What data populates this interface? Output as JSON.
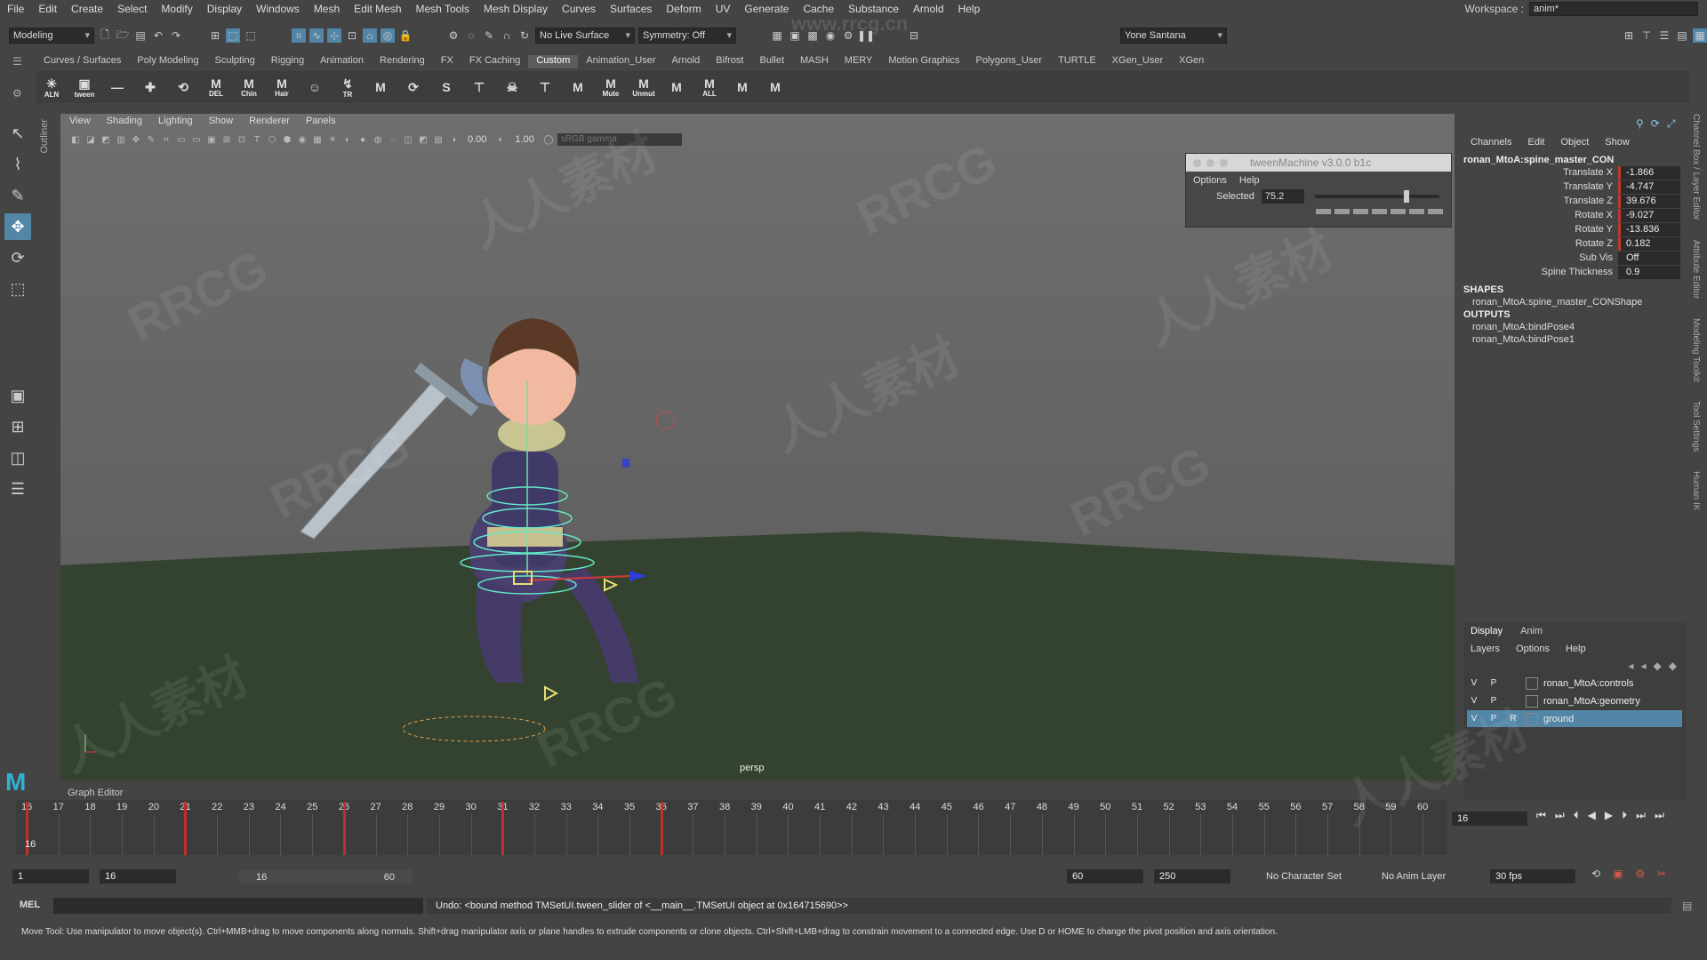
{
  "menubar": {
    "items": [
      "File",
      "Edit",
      "Create",
      "Select",
      "Modify",
      "Display",
      "Windows",
      "Mesh",
      "Edit Mesh",
      "Mesh Tools",
      "Mesh Display",
      "Curves",
      "Surfaces",
      "Deform",
      "UV",
      "Generate",
      "Cache",
      "Substance",
      "Arnold",
      "Help"
    ],
    "workspace_label": "Workspace :",
    "workspace_value": "anim*"
  },
  "statusline": {
    "mode": "Modeling",
    "live_surface": "No Live Surface",
    "symmetry": "Symmetry: Off",
    "user": "Yone Santana"
  },
  "shelf": {
    "tabs": [
      "Curves / Surfaces",
      "Poly Modeling",
      "Sculpting",
      "Rigging",
      "Animation",
      "Rendering",
      "FX",
      "FX Caching",
      "Custom",
      "Animation_User",
      "Arnold",
      "Bifrost",
      "Bullet",
      "MASH",
      "MERY",
      "Motion Graphics",
      "Polygons_User",
      "TURTLE",
      "XGen_User",
      "XGen"
    ],
    "active_tab": "Custom",
    "buttons": [
      {
        "glyph": "✳",
        "label": "ALN"
      },
      {
        "glyph": "▣",
        "label": "tween"
      },
      {
        "glyph": "—",
        "label": ""
      },
      {
        "glyph": "✚",
        "label": ""
      },
      {
        "glyph": "⟲",
        "label": ""
      },
      {
        "glyph": "M",
        "label": "DEL"
      },
      {
        "glyph": "M",
        "label": "Chin"
      },
      {
        "glyph": "M",
        "label": "Hair"
      },
      {
        "glyph": "☺",
        "label": ""
      },
      {
        "glyph": "↯",
        "label": "TR"
      },
      {
        "glyph": "M",
        "label": ""
      },
      {
        "glyph": "⟳",
        "label": ""
      },
      {
        "glyph": "S",
        "label": ""
      },
      {
        "glyph": "⊤",
        "label": ""
      },
      {
        "glyph": "☠",
        "label": ""
      },
      {
        "glyph": "⊤",
        "label": ""
      },
      {
        "glyph": "M",
        "label": ""
      },
      {
        "glyph": "M",
        "label": "Mute"
      },
      {
        "glyph": "M",
        "label": "Unmut"
      },
      {
        "glyph": "M",
        "label": ""
      },
      {
        "glyph": "M",
        "label": "ALL"
      },
      {
        "glyph": "M",
        "label": ""
      },
      {
        "glyph": "M",
        "label": ""
      }
    ]
  },
  "viewport": {
    "menu": [
      "View",
      "Shading",
      "Lighting",
      "Show",
      "Renderer",
      "Panels"
    ],
    "exposure": "0.00",
    "gamma": "1.00",
    "colorspace": "sRGB gamma",
    "camera": "persp",
    "outliner_label": "Outliner"
  },
  "tween_machine": {
    "title": "tweenMachine v3.0.0 b1c",
    "menu": [
      "Options",
      "Help"
    ],
    "selected_label": "Selected",
    "value": "75.2",
    "slider_fraction": 0.75
  },
  "channel_box": {
    "menu": [
      "Channels",
      "Edit",
      "Object",
      "Show"
    ],
    "node": "ronan_MtoA:spine_master_CON",
    "attributes": [
      {
        "name": "Translate X",
        "value": "-1.866",
        "keyed": true
      },
      {
        "name": "Translate Y",
        "value": "-4.747",
        "keyed": true
      },
      {
        "name": "Translate Z",
        "value": "39.676",
        "keyed": true
      },
      {
        "name": "Rotate X",
        "value": "-9.027",
        "keyed": true
      },
      {
        "name": "Rotate Y",
        "value": "-13.836",
        "keyed": true
      },
      {
        "name": "Rotate Z",
        "value": "0.182",
        "keyed": true
      },
      {
        "name": "Sub Vis",
        "value": "Off",
        "keyed": false
      },
      {
        "name": "Spine Thickness",
        "value": "0.9",
        "keyed": false
      }
    ],
    "shapes_header": "SHAPES",
    "shapes": [
      "ronan_MtoA:spine_master_CONShape"
    ],
    "outputs_header": "OUTPUTS",
    "outputs": [
      "ronan_MtoA:bindPose4",
      "ronan_MtoA:bindPose1"
    ]
  },
  "right_tabs": [
    "Channel Box / Layer Editor",
    "Attribute Editor",
    "Modeling Toolkit",
    "Tool Settings",
    "Human IK"
  ],
  "layers": {
    "tabs": [
      "Display",
      "Anim"
    ],
    "menu": [
      "Layers",
      "Options",
      "Help"
    ],
    "rows": [
      {
        "v": "V",
        "p": "P",
        "r": "",
        "name": "ronan_MtoA:controls",
        "selected": false
      },
      {
        "v": "V",
        "p": "P",
        "r": "",
        "name": "ronan_MtoA:geometry",
        "selected": false
      },
      {
        "v": "V",
        "p": "P",
        "r": "R",
        "name": "ground",
        "selected": true
      }
    ]
  },
  "timeline": {
    "graph_editor_label": "Graph Editor",
    "frames": [
      "16",
      "17",
      "18",
      "19",
      "20",
      "21",
      "22",
      "23",
      "24",
      "25",
      "26",
      "27",
      "28",
      "29",
      "30",
      "31",
      "32",
      "33",
      "34",
      "35",
      "36",
      "37",
      "38",
      "39",
      "40",
      "41",
      "42",
      "43",
      "44",
      "45",
      "46",
      "47",
      "48",
      "49",
      "50",
      "51",
      "52",
      "53",
      "54",
      "55",
      "56",
      "57",
      "58",
      "59",
      "60"
    ],
    "keys": [
      16,
      21,
      26,
      31,
      36
    ],
    "current_frame": "16",
    "current_frame_field": "16"
  },
  "range": {
    "start": "1",
    "playback_start": "16",
    "range_start": "16",
    "range_end": "60",
    "playback_end": "60",
    "end": "250",
    "character_set": "No Character Set",
    "anim_layer": "No Anim Layer",
    "fps": "30 fps"
  },
  "command": {
    "mel_label": "MEL",
    "result": "Undo: <bound method TMSetUI.tween_slider of <__main__.TMSetUI object at 0x164715690>>",
    "help": "Move Tool: Use manipulator to move object(s). Ctrl+MMB+drag to move components along normals. Shift+drag manipulator axis or plane handles to extrude components or clone objects. Ctrl+Shift+LMB+drag to constrain movement to a connected edge. Use D or HOME to change the pivot position and axis orientation."
  },
  "colors": {
    "accent": "#5285a6",
    "key": "#c0302a",
    "ground": "#33432f",
    "maya_logo": "#2fb2d8"
  },
  "watermarks": [
    "RRCG",
    "人人素材",
    "www.rrcg.cn"
  ]
}
